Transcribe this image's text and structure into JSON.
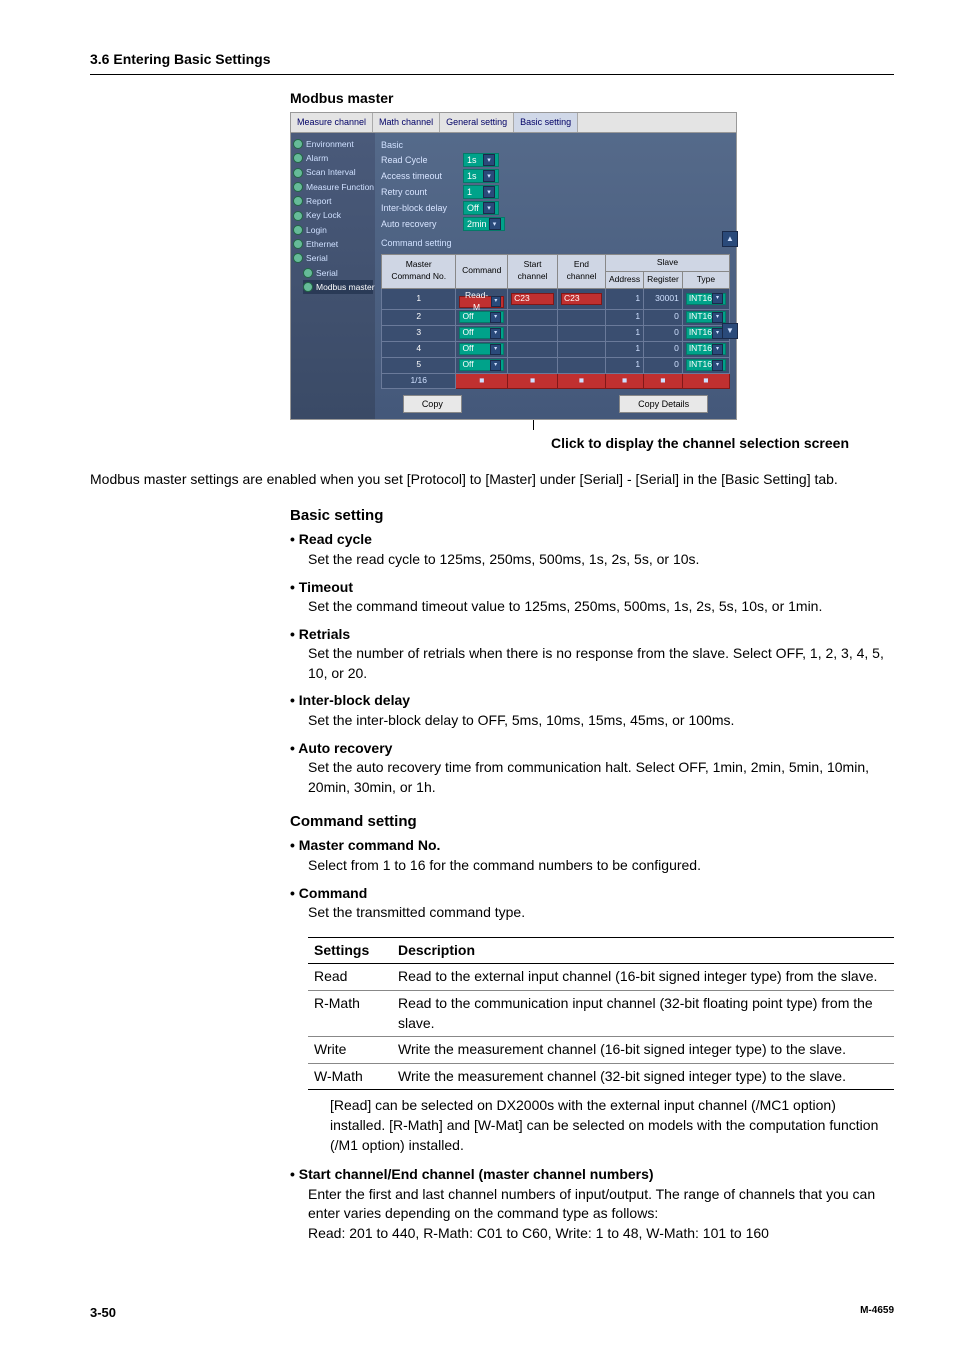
{
  "header": {
    "section": "3.6  Entering Basic Settings"
  },
  "title": "Modbus master",
  "shot": {
    "tabs": [
      "Measure channel",
      "Math channel",
      "General setting",
      "Basic setting"
    ],
    "sidebar": [
      {
        "label": "Environment",
        "sub": false
      },
      {
        "label": "Alarm",
        "sub": false
      },
      {
        "label": "Scan Interval",
        "sub": false
      },
      {
        "label": "Measure Function",
        "sub": false
      },
      {
        "label": "Report",
        "sub": false
      },
      {
        "label": "Key Lock",
        "sub": false
      },
      {
        "label": "Login",
        "sub": false
      },
      {
        "label": "Ethernet",
        "sub": false
      },
      {
        "label": "Serial",
        "sub": false,
        "open": true
      },
      {
        "label": "Serial",
        "sub": true
      },
      {
        "label": "Modbus master",
        "sub": true,
        "sel": true
      }
    ],
    "basic_label": "Basic",
    "fields": [
      {
        "lab": "Read Cycle",
        "val": "1s"
      },
      {
        "lab": "Access timeout",
        "val": "1s"
      },
      {
        "lab": "Retry count",
        "val": "1"
      },
      {
        "lab": "Inter-block delay",
        "val": "Off"
      },
      {
        "lab": "Auto recovery",
        "val": "2min"
      }
    ],
    "cmd_label": "Command setting",
    "thead": [
      "Master Command No.",
      "Command",
      "Start channel",
      "End channel",
      "Address",
      "Register",
      "Type"
    ],
    "thead_group": "Slave",
    "rows": [
      {
        "n": "1",
        "cmd": "Read-M",
        "sel": true,
        "sc": "C23",
        "ec": "C23",
        "addr": "1",
        "reg": "30001",
        "type": "INT16"
      },
      {
        "n": "2",
        "cmd": "Off",
        "sel": false,
        "sc": "",
        "ec": "",
        "addr": "1",
        "reg": "0",
        "type": "INT16"
      },
      {
        "n": "3",
        "cmd": "Off",
        "sel": false,
        "sc": "",
        "ec": "",
        "addr": "1",
        "reg": "0",
        "type": "INT16"
      },
      {
        "n": "4",
        "cmd": "Off",
        "sel": false,
        "sc": "",
        "ec": "",
        "addr": "1",
        "reg": "0",
        "type": "INT16"
      },
      {
        "n": "5",
        "cmd": "Off",
        "sel": false,
        "sc": "",
        "ec": "",
        "addr": "1",
        "reg": "0",
        "type": "INT16"
      }
    ],
    "copy_btn": "Copy",
    "copy_details_btn": "Copy Details"
  },
  "callout": "Click to display the channel selection screen",
  "intro": "Modbus master settings are enabled when you set [Protocol] to [Master] under [Serial] - [Serial] in the [Basic Setting] tab.",
  "basic": {
    "head": "Basic setting",
    "items": [
      {
        "t": "Read cycle",
        "d": "Set the read cycle to 125ms, 250ms, 500ms, 1s, 2s, 5s, or 10s."
      },
      {
        "t": "Timeout",
        "d": "Set the command timeout value to 125ms, 250ms, 500ms, 1s, 2s, 5s, 10s, or 1min."
      },
      {
        "t": "Retrials",
        "d": "Set the number of retrials when there is no response from the slave.  Select OFF, 1, 2, 3, 4, 5, 10, or 20."
      },
      {
        "t": "Inter-block delay",
        "d": "Set the inter-block delay to OFF, 5ms, 10ms, 15ms, 45ms, or 100ms."
      },
      {
        "t": "Auto recovery",
        "d": "Set the auto recovery time from communication halt.  Select OFF, 1min, 2min, 5min, 10min, 20min, 30min, or 1h."
      }
    ]
  },
  "cmd": {
    "head": "Command setting",
    "items": [
      {
        "t": "Master command No.",
        "d": "Select from 1 to 16 for the command numbers to be configured."
      },
      {
        "t": "Command",
        "d": "Set the transmitted command type."
      }
    ],
    "table": {
      "cols": [
        "Settings",
        "Description"
      ],
      "rows": [
        {
          "s": "Read",
          "d": "Read to the external input channel (16-bit signed integer type) from the slave."
        },
        {
          "s": "R-Math",
          "d": "Read to the communication input channel (32-bit floating point type) from the slave."
        },
        {
          "s": "Write",
          "d": "Write the measurement channel (16-bit signed integer type) to the slave."
        },
        {
          "s": "W-Math",
          "d": "Write the measurement channel (32-bit signed integer type) to the slave."
        }
      ]
    },
    "note": "[Read] can be selected on DX2000s with the external input channel (/MC1 option) installed. [R-Math] and [W-Mat] can be selected on models with the computation function (/M1 option) installed.",
    "ch": {
      "t": "Start channel/End channel (master channel numbers)",
      "d": "Enter the first and last channel numbers of input/output.  The range of channels that you can enter varies depending on the command type as follows:",
      "r": "Read: 201 to 440, R-Math: C01 to C60, Write: 1 to 48, W-Math: 101 to 160"
    }
  },
  "footer": {
    "page": "3-50",
    "code": "M-4659"
  }
}
